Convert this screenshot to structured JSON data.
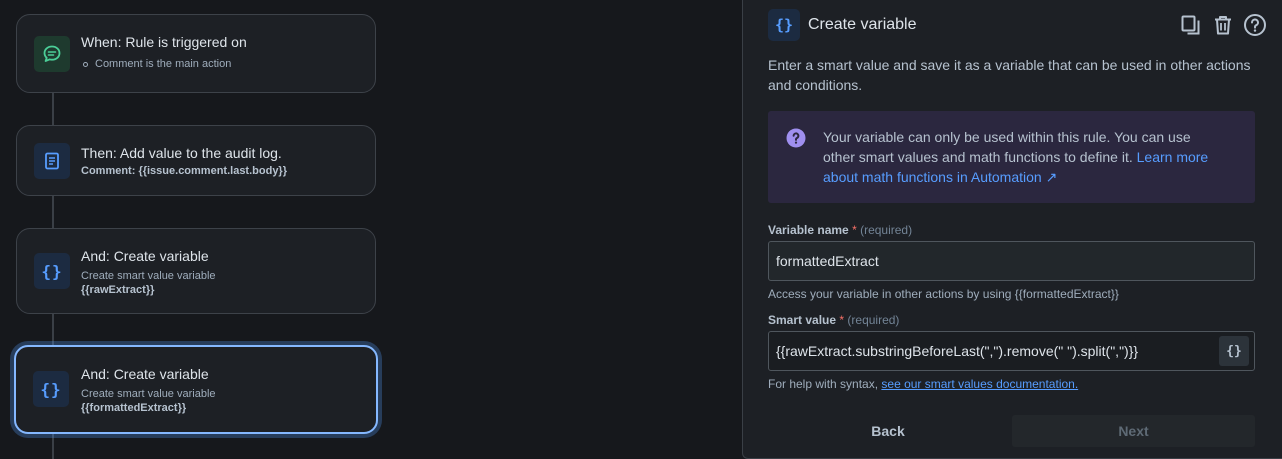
{
  "flow": {
    "cards": [
      {
        "title": "When: Rule is triggered on",
        "bullet": "Comment is the main action",
        "icon": "chat-bubble-icon"
      },
      {
        "title": "Then: Add value to the audit log.",
        "detail": "Comment: {{issue.comment.last.body}}",
        "icon": "document-icon"
      },
      {
        "title": "And: Create variable",
        "subtitle": "Create smart value variable",
        "detail": "{{rawExtract}}",
        "icon": "braces-icon"
      },
      {
        "title": "And: Create variable",
        "subtitle": "Create smart value variable",
        "detail": "{{formattedExtract}}",
        "icon": "braces-icon",
        "selected": true
      }
    ],
    "braces_glyph": "{}"
  },
  "panel": {
    "title": "Create variable",
    "header_icon": "{}",
    "actions": [
      "duplicate-icon",
      "trash-icon",
      "help-icon"
    ],
    "description": "Enter a smart value and save it as a variable that can be used in other actions and conditions.",
    "info": {
      "text": "Your variable can only be used within this rule. You can use other smart values and math functions to define it.",
      "link": "Learn more about math functions in Automation ↗"
    },
    "variable_name": {
      "label": "Variable name",
      "required_mark": "*",
      "required_text": "(required)",
      "value": "formattedExtract",
      "hint": "Access your variable in other actions by using {{formattedExtract}}"
    },
    "smart_value": {
      "label": "Smart value",
      "required_mark": "*",
      "required_text": "(required)",
      "value": "{{rawExtract.substringBeforeLast(\",\").remove(\" \").split(\",\")}}",
      "button": "{}",
      "hint_prefix": "For help with syntax,",
      "hint_link": "see our smart values documentation."
    },
    "buttons": {
      "back": "Back",
      "next": "Next"
    }
  },
  "colors": {
    "accent": "#579dff",
    "selected_border": "#85b8ff",
    "info_bg": "#2b273f",
    "required": "#f87168"
  }
}
